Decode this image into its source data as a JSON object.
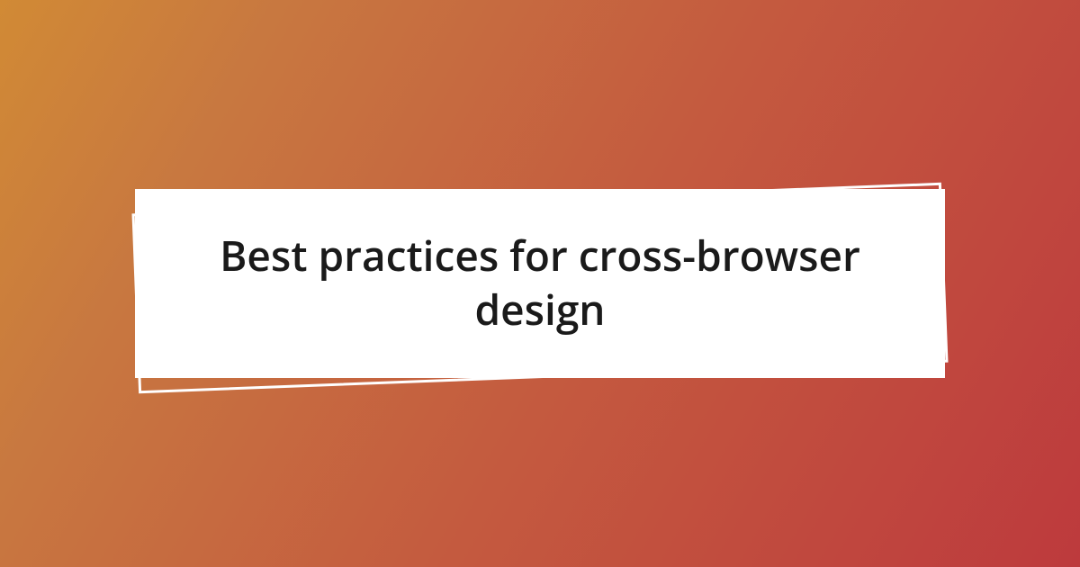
{
  "title": "Best practices for cross-browser design"
}
